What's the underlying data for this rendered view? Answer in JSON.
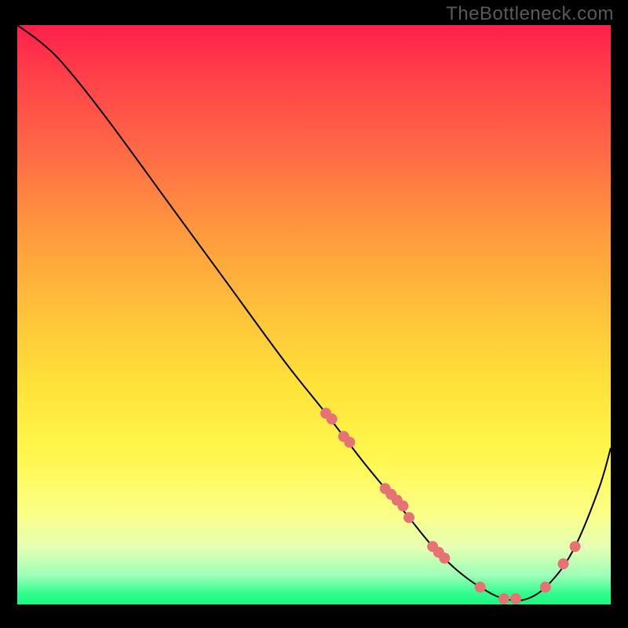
{
  "watermark": "TheBottleneck.com",
  "colors": {
    "background": "#000000",
    "curve": "#000000",
    "dot": "#e57373",
    "gradient_top": "#ff1f4a",
    "gradient_bottom": "#18f97f"
  },
  "chart_data": {
    "type": "line",
    "title": "",
    "xlabel": "",
    "ylabel": "",
    "xlim": [
      0,
      100
    ],
    "ylim": [
      0,
      100
    ],
    "series": [
      {
        "name": "bottleneck-curve",
        "x": [
          0,
          4,
          8,
          15,
          25,
          35,
          45,
          52,
          58,
          62,
          66,
          70,
          74,
          78,
          82,
          86,
          90,
          94,
          98,
          100
        ],
        "y": [
          100,
          97,
          93,
          84,
          70,
          56,
          42,
          33,
          25,
          20,
          15,
          10,
          6,
          3,
          1,
          1,
          4,
          10,
          20,
          27
        ]
      }
    ],
    "scatter": [
      {
        "name": "highlighted-points",
        "x": [
          52,
          53,
          55,
          56,
          62,
          63,
          64,
          65,
          66,
          70,
          71,
          72,
          78,
          82,
          84,
          89,
          92,
          94
        ],
        "y": [
          33,
          32,
          29,
          28,
          20,
          19,
          18,
          17,
          15,
          10,
          9,
          8,
          3,
          1,
          1,
          3,
          7,
          10
        ]
      }
    ]
  }
}
